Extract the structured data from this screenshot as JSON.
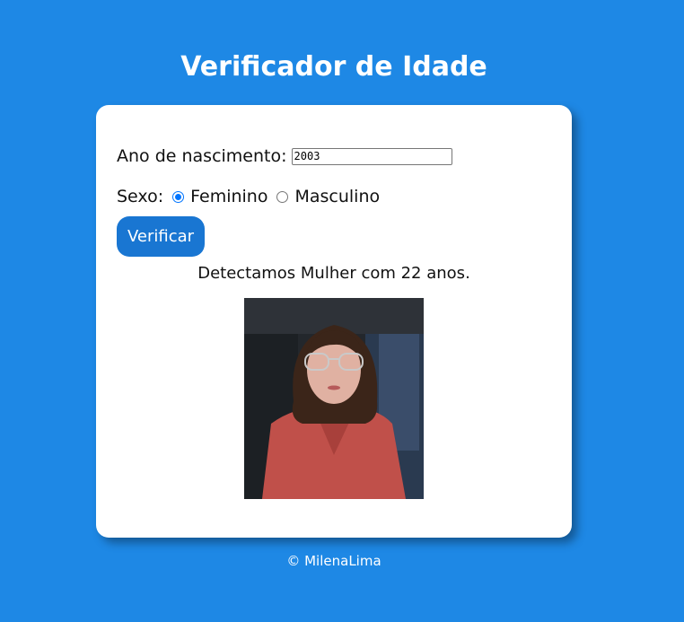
{
  "header": {
    "title": "Verificador de Idade"
  },
  "form": {
    "birth_year_label": "Ano de nascimento:",
    "birth_year_value": "2003",
    "sex_label": "Sexo:",
    "options": [
      {
        "label": "Feminino",
        "checked": true
      },
      {
        "label": "Masculino",
        "checked": false
      }
    ],
    "verify_button": "Verificar"
  },
  "result": {
    "text": "Detectamos Mulher com 22 anos.",
    "photo_icon": "woman-portrait-photo"
  },
  "footer": {
    "text": "© MilenaLima"
  },
  "colors": {
    "background": "#1e88e5",
    "card": "#ffffff",
    "button": "#1976d2",
    "radio_accent": "#0075ff"
  }
}
